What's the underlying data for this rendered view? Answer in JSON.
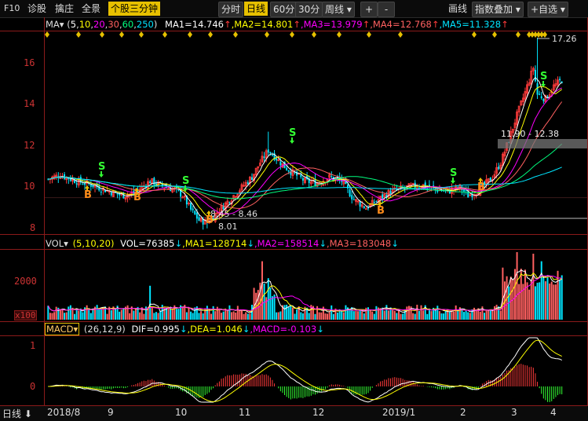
{
  "toolbar": {
    "f10": "F10",
    "diagnose": "诊股",
    "wobble": "擒庄",
    "panorama": "全景",
    "three_minute": "个股三分钟",
    "time_share": "分时",
    "daily": "日线",
    "min60": "60分",
    "min30": "30分",
    "weekly": "周线",
    "weekly_arrow": "▾",
    "plus": "+",
    "minus": "-",
    "draw": "画线",
    "index_overlay": "指数叠加",
    "add_watch": "+自选"
  },
  "ma_legend": {
    "name": "MA",
    "params_open": "(",
    "p1": "5",
    "p2": "10",
    "p3": "20",
    "p4": "30",
    "p5": "60",
    "p6": "250",
    "params_close": ")",
    "ma1": "MA1=14.746",
    "ma2": ",MA2=14.801",
    "ma3": ",MA3=13.979",
    "ma4": ",MA4=12.768",
    "ma5": ",MA5=11.328",
    "up_arrow": "↑"
  },
  "price_axis": [
    "16",
    "14",
    "12",
    "10",
    "8"
  ],
  "annotations": {
    "high": "17.26",
    "zone": "11.90 - 12.38",
    "range_low": "8.45 - 8.46",
    "low": "8.01",
    "buy": "B",
    "sell": "S"
  },
  "vol_legend": {
    "name": "VOL",
    "params": "(5,10,20)",
    "vol": "VOL=76385",
    "ma1": ",MA1=128714",
    "ma2": ",MA2=158514",
    "ma3": ",MA3=183048",
    "down_arrow": "↓"
  },
  "vol_axis": {
    "value": "2000",
    "unit": "x100"
  },
  "macd_legend": {
    "name": "MACD",
    "params": "(26,12,9)",
    "dif": "DIF=0.995",
    "dea": ",DEA=1.046",
    "macd": ",MACD=-0.103",
    "down_arrow": "↓"
  },
  "macd_axis": [
    "1",
    "0"
  ],
  "x_axis": [
    "2018/8",
    "9",
    "10",
    "11",
    "12",
    "2019/1",
    "2",
    "3",
    "4"
  ],
  "period_label": "日线",
  "colors": {
    "up": "#ff3b3b",
    "down": "#00e5ff",
    "ma1": "#ffffff",
    "ma2": "#ffff00",
    "ma3": "#ff00ff",
    "ma4": "#ff6060",
    "ma5": "#00ff7f",
    "border": "#8b1a1a"
  }
}
